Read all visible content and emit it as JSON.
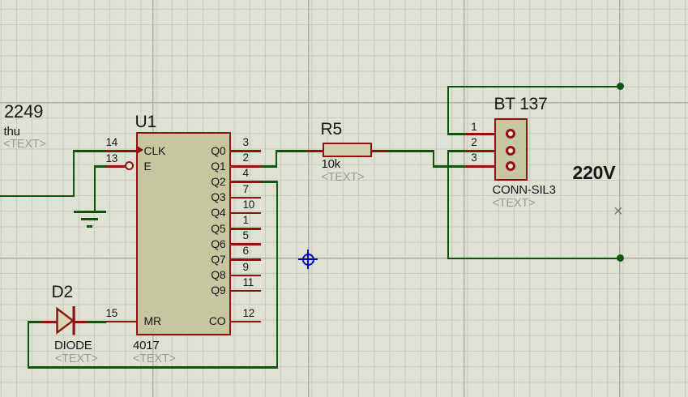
{
  "colors": {
    "background": "#dfe1d3",
    "grid_minor": "#c7cabb",
    "grid_major": "#adb1a0",
    "wire": "#0c5410",
    "component_outline": "#8e1212",
    "component_fill": "#c6c6a1",
    "resistor_fill": "#d3d1b0",
    "diode_fill": "#d9d6b5",
    "text": "#161616",
    "placeholder_text": "#9b9b9b",
    "origin_marker": "#0000bb",
    "cross_marker": "#777777"
  },
  "annotations": {
    "top_left_value": "2249",
    "top_left_caption": "thu",
    "top_left_placeholder": "<TEXT>",
    "voltage": "220V",
    "cross": "×"
  },
  "u1": {
    "ref": "U1",
    "device": "4017",
    "placeholder": "<TEXT>",
    "left_pins": [
      {
        "num": "14",
        "name": "CLK"
      },
      {
        "num": "13",
        "name": "E"
      },
      {
        "num": "15",
        "name": "MR"
      }
    ],
    "right_pins": [
      {
        "num": "3",
        "name": "Q0"
      },
      {
        "num": "2",
        "name": "Q1"
      },
      {
        "num": "4",
        "name": "Q2"
      },
      {
        "num": "7",
        "name": "Q3"
      },
      {
        "num": "10",
        "name": "Q4"
      },
      {
        "num": "1",
        "name": "Q5"
      },
      {
        "num": "5",
        "name": "Q6"
      },
      {
        "num": "6",
        "name": "Q7"
      },
      {
        "num": "9",
        "name": "Q8"
      },
      {
        "num": "11",
        "name": "Q9"
      },
      {
        "num": "12",
        "name": "CO"
      }
    ]
  },
  "d2": {
    "ref": "D2",
    "device": "DIODE",
    "placeholder": "<TEXT>"
  },
  "r5": {
    "ref": "R5",
    "device": "10k",
    "placeholder": "<TEXT>"
  },
  "j1": {
    "ref": "BT 137",
    "device": "CONN-SIL3",
    "placeholder": "<TEXT>",
    "pins": [
      "1",
      "2",
      "3"
    ]
  }
}
